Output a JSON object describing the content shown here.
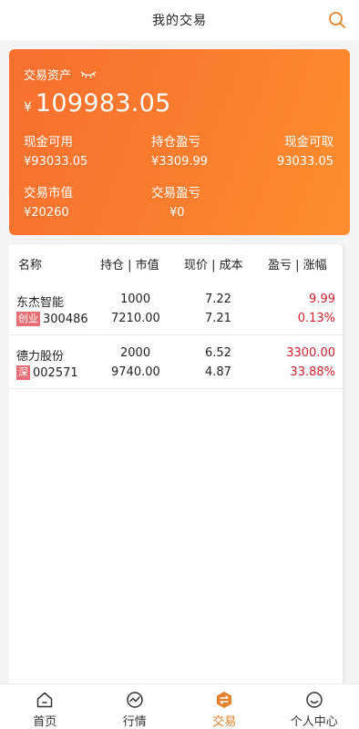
{
  "header": {
    "title": "我的交易"
  },
  "asset": {
    "label": "交易资产",
    "currency": "¥",
    "total": "109983.05",
    "stats": [
      {
        "label": "现金可用",
        "value": "¥93033.05"
      },
      {
        "label": "持仓盈亏",
        "value": "¥3309.99"
      },
      {
        "label": "现金可取",
        "value": "93033.05"
      },
      {
        "label": "交易市值",
        "value": "¥20260"
      },
      {
        "label": "交易盈亏",
        "value": "¥0"
      }
    ]
  },
  "table": {
    "headers": [
      "名称",
      "持仓 | 市值",
      "现价 | 成本",
      "盈亏 | 涨幅"
    ],
    "rows": [
      {
        "name": "东杰智能",
        "badge": "创业",
        "code": "300486",
        "qty": "1000",
        "market_value": "7210.00",
        "price": "7.22",
        "cost": "7.21",
        "pnl": "9.99",
        "pct": "0.13%"
      },
      {
        "name": "德力股份",
        "badge": "深",
        "code": "002571",
        "qty": "2000",
        "market_value": "9740.00",
        "price": "6.52",
        "cost": "4.87",
        "pnl": "3300.00",
        "pct": "33.88%"
      }
    ]
  },
  "tabs": [
    {
      "label": "首页",
      "icon": "home-icon"
    },
    {
      "label": "行情",
      "icon": "chart-icon"
    },
    {
      "label": "交易",
      "icon": "trade-icon"
    },
    {
      "label": "个人中心",
      "icon": "profile-icon"
    }
  ],
  "colors": {
    "accent": "#e3812c",
    "card_start": "#f86f2e",
    "card_end": "#fd8e2e",
    "up": "#d51e29",
    "badge": "#e86d75"
  }
}
